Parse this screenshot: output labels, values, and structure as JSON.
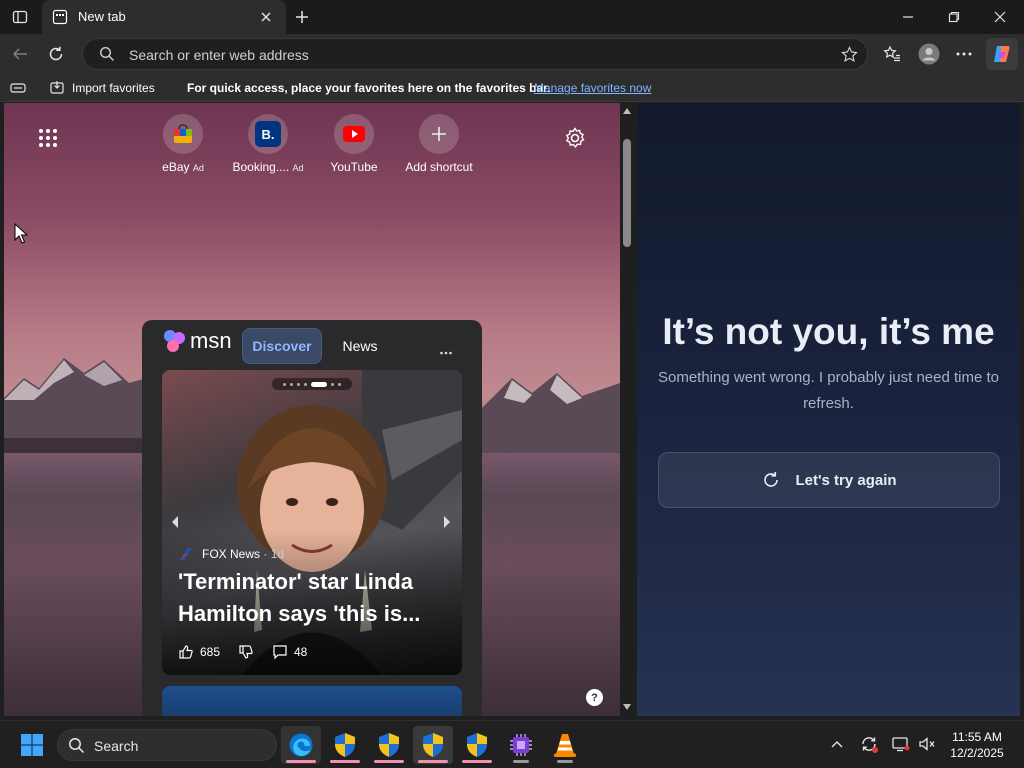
{
  "browser": {
    "tab_title": "New tab",
    "omnibox_placeholder": "Search or enter web address"
  },
  "favorites_bar": {
    "import_label": "Import favorites",
    "hint": "For quick access, place your favorites here on the favorites bar.",
    "manage_link": "Manage favorites now"
  },
  "shortcuts": [
    {
      "label": "eBay",
      "ad": "Ad",
      "icon": "ebay-bag-icon"
    },
    {
      "label": "Booking....",
      "ad": "Ad",
      "icon": "booking-b-icon"
    },
    {
      "label": "YouTube",
      "ad": "",
      "icon": "youtube-icon"
    },
    {
      "label": "Add shortcut",
      "ad": "",
      "icon": "plus-icon"
    }
  ],
  "msn": {
    "brand": "msn",
    "tabs": [
      "Discover",
      "News"
    ],
    "active_tab": "Discover",
    "story": {
      "source": "FOX News",
      "age": "· 1d",
      "headline": "'Terminator' star Linda Hamilton says 'this is...",
      "likes": "685",
      "comments": "48"
    }
  },
  "error_panel": {
    "title": "It’s not you, it’s me",
    "subtitle": "Something went wrong. I probably just need time to refresh.",
    "retry_label": "Let's try again"
  },
  "taskbar": {
    "search_placeholder": "Search",
    "time": "11:55 AM",
    "date": "12/2/2025"
  },
  "colors": {
    "accent_link": "#7eb6ff",
    "active_tab_bg": "#3a4a66",
    "taskbar_active_underline": "#f48fb1"
  }
}
